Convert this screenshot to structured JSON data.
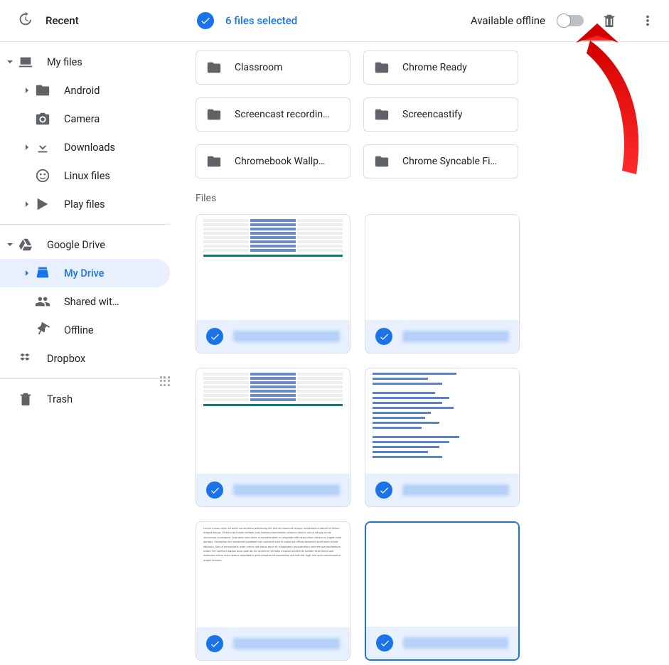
{
  "topbar": {
    "recent_label": "Recent",
    "selection_text": "6 files selected",
    "offline_label": "Available offline"
  },
  "sidebar": {
    "my_files": "My files",
    "android": "Android",
    "camera": "Camera",
    "downloads": "Downloads",
    "linux": "Linux files",
    "play": "Play files",
    "gdrive": "Google Drive",
    "mydrive": "My Drive",
    "shared": "Shared wit…",
    "offline": "Offline",
    "dropbox": "Dropbox",
    "trash": "Trash"
  },
  "folders": [
    {
      "label": "Classroom"
    },
    {
      "label": "Chrome Ready"
    },
    {
      "label": "Screencast recordin…"
    },
    {
      "label": "Screencastify"
    },
    {
      "label": "Chromebook Wallp…"
    },
    {
      "label": "Chrome Syncable Fi…"
    }
  ],
  "files_section_label": "Files"
}
